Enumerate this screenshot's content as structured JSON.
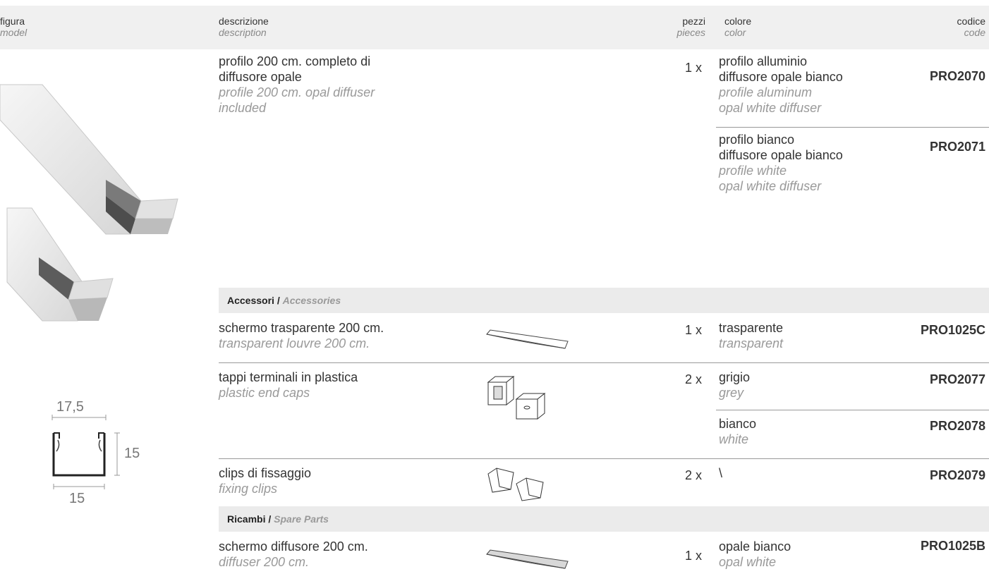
{
  "header": {
    "figura": "figura",
    "model": "model",
    "descrizione": "descrizione",
    "description": "description",
    "pezzi": "pezzi",
    "pieces": "pieces",
    "colore": "colore",
    "color": "color",
    "codice": "codice",
    "code": "code"
  },
  "product": {
    "desc_it_1": "profilo 200 cm. completo di",
    "desc_it_2": "diffusore opale",
    "desc_en_1": "profile 200 cm. opal diffuser",
    "desc_en_2": "included",
    "qty": "1 x",
    "variants": [
      {
        "it_1": "profilo alluminio",
        "it_2": "diffusore opale bianco",
        "en_1": "profile aluminum",
        "en_2": "opal white diffuser",
        "code": "PRO2070"
      },
      {
        "it_1": "profilo bianco",
        "it_2": "diffusore opale bianco",
        "en_1": "profile white",
        "en_2": "opal white diffuser",
        "code": "PRO2071"
      }
    ]
  },
  "accessories": {
    "title_it": "Accessori",
    "sep": " / ",
    "title_en": "Accessories",
    "items": [
      {
        "desc_it": "schermo trasparente 200 cm.",
        "desc_en": "transparent louvre 200 cm.",
        "qty": "1 x",
        "color_it": "trasparente",
        "color_en": "transparent",
        "code": "PRO1025C",
        "icon": "louvre-strip-icon"
      },
      {
        "desc_it": "tappi terminali in plastica",
        "desc_en": "plastic end caps",
        "qty": "2 x",
        "color_it": "grigio",
        "color_en": "grey",
        "code": "PRO2077",
        "icon": "end-caps-icon"
      },
      {
        "color_it": "bianco",
        "color_en": "white",
        "code": "PRO2078"
      },
      {
        "desc_it": "clips di fissaggio",
        "desc_en": "fixing clips",
        "qty": "2 x",
        "color_it": "\\",
        "code": "PRO2079",
        "icon": "fixing-clips-icon"
      }
    ]
  },
  "spare_parts": {
    "title_it": "Ricambi",
    "sep": " / ",
    "title_en": "Spare Parts",
    "items": [
      {
        "desc_it": "schermo diffusore 200 cm.",
        "desc_en": "diffuser 200 cm.",
        "qty": "1 x",
        "color_it": "opale bianco",
        "color_en": "opal white",
        "code": "PRO1025B",
        "icon": "diffuser-strip-icon"
      }
    ]
  },
  "drawing": {
    "width_top": "17,5",
    "height": "15",
    "width_bottom": "15"
  },
  "colors": {
    "header_bg": "#f0f0f0",
    "section_bg": "#ebebeb",
    "text": "#333333",
    "muted": "#999999"
  }
}
